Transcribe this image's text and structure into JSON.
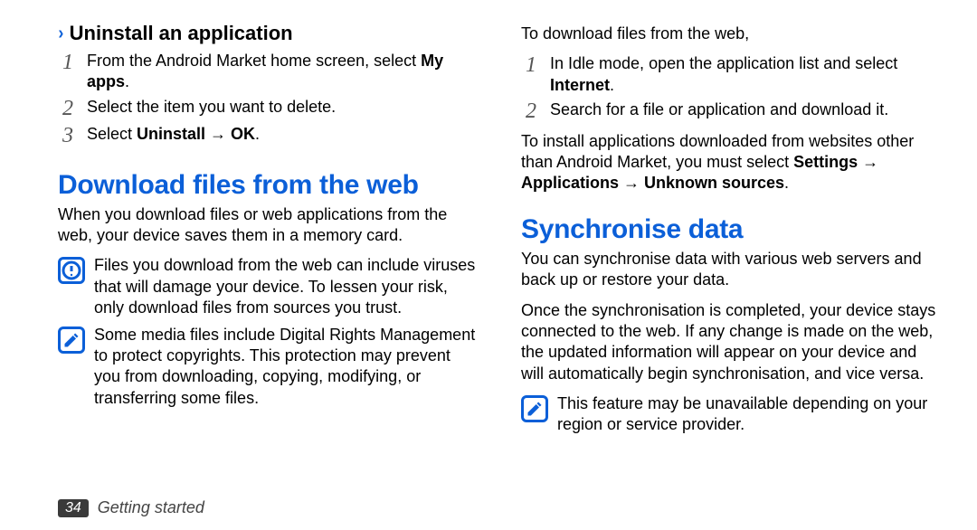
{
  "left": {
    "subheading": "Uninstall an application",
    "steps": [
      {
        "pre": "From the Android Market home screen, select ",
        "bold": "My apps",
        "post": "."
      },
      {
        "pre": "Select the item you want to delete.",
        "bold": "",
        "post": ""
      },
      {
        "pre": "Select ",
        "bold": "Uninstall → OK",
        "post": "."
      }
    ],
    "heading2": "Download files from the web",
    "intro": "When you download files or web applications from the web, your device saves them in a memory card.",
    "warn": "Files you download from the web can include viruses that will damage your device. To lessen your risk, only download files from sources you trust.",
    "drm": "Some media files include Digital Rights Management to protect copyrights. This protection may prevent you from downloading, copying, modifying, or transferring some files."
  },
  "right": {
    "lead": "To download files from the web,",
    "steps": [
      {
        "pre": "In Idle mode, open the application list and select ",
        "bold": "Internet",
        "post": "."
      },
      {
        "pre": "Search for a file or application and download it.",
        "bold": "",
        "post": ""
      }
    ],
    "install_pre": "To install applications downloaded from websites other than Android Market, you must select ",
    "install_bold": "Settings → Applications → Unknown sources",
    "install_post": ".",
    "heading2": "Synchronise data",
    "sync1": "You can synchronise data with various web servers and back up or restore your data.",
    "sync2": "Once the synchronisation is completed, your device stays connected to the web. If any change is made on the web, the updated information will appear on your device and will automatically begin synchronisation, and vice versa.",
    "note": "This feature may be unavailable depending on your region or service provider."
  },
  "footer": {
    "page": "34",
    "section": "Getting started"
  }
}
